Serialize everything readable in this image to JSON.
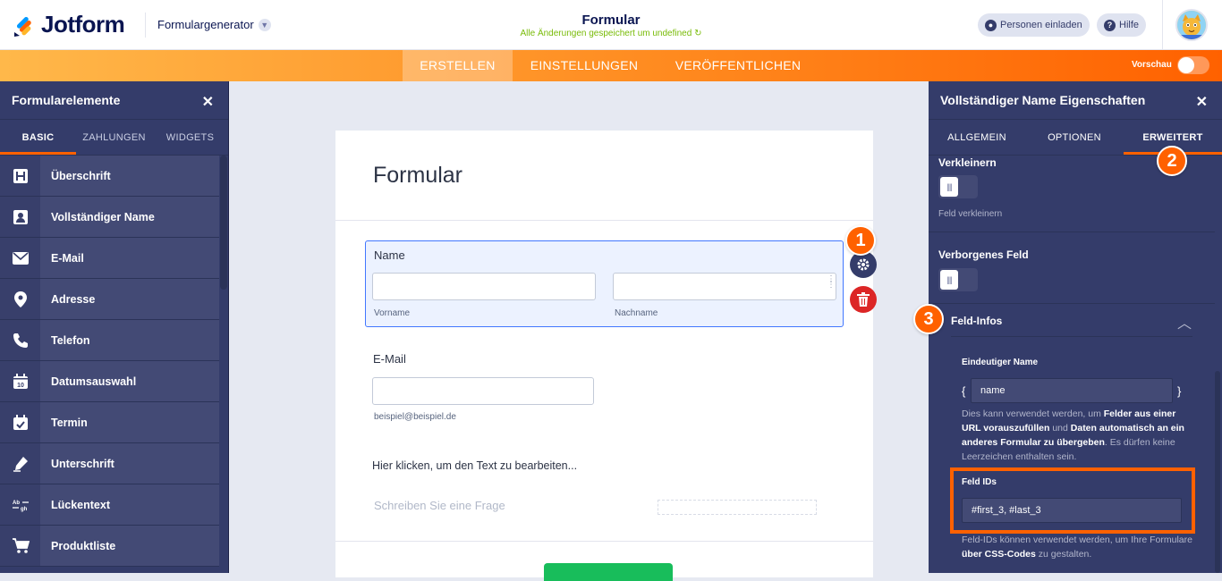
{
  "app": {
    "logo_text": "Jotform",
    "generator_label": "Formulargenerator",
    "form_title": "Formular",
    "saved_status": "Alle Änderungen gespeichert um undefined",
    "invite_label": "Personen einladen",
    "help_label": "Hilfe"
  },
  "nav": {
    "tabs": [
      "ERSTELLEN",
      "EINSTELLUNGEN",
      "VERÖFFENTLICHEN"
    ],
    "active_tab": "ERSTELLEN",
    "preview_label": "Vorschau"
  },
  "left_panel": {
    "title": "Formularelemente",
    "tabs": [
      "BASIC",
      "ZAHLUNGEN",
      "WIDGETS"
    ],
    "active_tab": "BASIC",
    "items": [
      {
        "label": "Überschrift",
        "icon": "heading-icon"
      },
      {
        "label": "Vollständiger Name",
        "icon": "contact-card-icon"
      },
      {
        "label": "E-Mail",
        "icon": "envelope-icon"
      },
      {
        "label": "Adresse",
        "icon": "map-pin-icon"
      },
      {
        "label": "Telefon",
        "icon": "phone-icon"
      },
      {
        "label": "Datumsauswahl",
        "icon": "calendar-icon"
      },
      {
        "label": "Termin",
        "icon": "calendar-check-icon"
      },
      {
        "label": "Unterschrift",
        "icon": "pen-icon"
      },
      {
        "label": "Lückentext",
        "icon": "fill-in-blank-icon"
      },
      {
        "label": "Produktliste",
        "icon": "cart-icon"
      }
    ]
  },
  "form": {
    "title": "Formular",
    "name_field": {
      "label": "Name",
      "sub_first": "Vorname",
      "sub_last": "Nachname"
    },
    "email_field": {
      "label": "E-Mail",
      "sub": "beispiel@beispiel.de"
    },
    "text_block": "Hier klicken, um den Text zu bearbeiten...",
    "question_placeholder": "Schreiben Sie eine Frage"
  },
  "badges": [
    "1",
    "2",
    "3"
  ],
  "right_panel": {
    "title": "Vollständiger Name Eigenschaften",
    "tabs": [
      "ALLGEMEIN",
      "OPTIONEN",
      "ERWEITERT"
    ],
    "active_tab": "ERWEITERT",
    "shrink_title": "Verkleinern",
    "shrink_desc": "Feld verkleinern",
    "hidden_title": "Verborgenes Feld",
    "field_info_title": "Feld-Infos",
    "unique_name_label": "Eindeutiger Name",
    "unique_name_value": "name",
    "brace_open": "{",
    "brace_close": "}",
    "unique_desc": {
      "p1": "Dies kann verwendet werden, um ",
      "b1": "Felder aus einer URL vorauszufüllen",
      "p2": " und ",
      "b2": "Daten automatisch an ein anderes Formular zu übergeben",
      "p3": ". Es dürfen keine Leerzeichen enthalten sein."
    },
    "field_ids_label": "Feld IDs",
    "field_ids_value": "#first_3, #last_3",
    "field_ids_desc": {
      "p1": "Feld-IDs können verwendet werden, um Ihre Formulare ",
      "b1": "über CSS-Codes",
      "p2": " zu gestalten."
    }
  },
  "colors": {
    "brand_orange": "#ff6100",
    "panel_navy": "#343c6a",
    "selection_blue": "#4277ff",
    "submit_green": "#18bd5b",
    "delete_red": "#dc2626"
  }
}
